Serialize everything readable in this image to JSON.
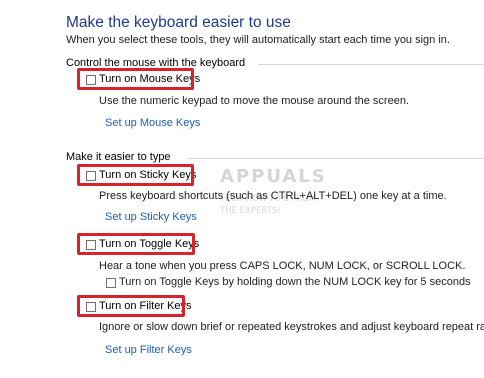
{
  "page": {
    "title": "Make the keyboard easier to use",
    "subtitle": "When you select these tools, they will automatically start each time you sign in."
  },
  "mouse_section": {
    "heading": "Control the mouse with the keyboard",
    "mouse_keys": {
      "label": "Turn on Mouse Keys",
      "checked": false,
      "description": "Use the numeric keypad to move the mouse around the screen.",
      "link": "Set up Mouse Keys"
    }
  },
  "typing_section": {
    "heading": "Make it easier to type",
    "sticky_keys": {
      "label": "Turn on Sticky Keys",
      "checked": false,
      "description": "Press keyboard shortcuts (such as CTRL+ALT+DEL) one key at a time.",
      "link": "Set up Sticky Keys"
    },
    "toggle_keys": {
      "label": "Turn on Toggle Keys",
      "checked": false,
      "description": "Hear a tone when you press CAPS LOCK, NUM LOCK, or SCROLL LOCK.",
      "sub_option": {
        "label": "Turn on Toggle Keys by holding down the NUM LOCK key for 5 seconds",
        "checked": false
      }
    },
    "filter_keys": {
      "label": "Turn on Filter Keys",
      "checked": false,
      "description": "Ignore or slow down brief or repeated keystrokes and adjust keyboard repeat rates.",
      "link": "Set up Filter Keys"
    }
  },
  "watermark": {
    "brand": "APPUALS",
    "tagline_line1": "TECH HOW-TO'S FROM",
    "tagline_line2": "THE EXPERTS!"
  },
  "colors": {
    "title": "#1e3a8c",
    "link": "#1f5fb4",
    "highlight": "#d8232a"
  }
}
